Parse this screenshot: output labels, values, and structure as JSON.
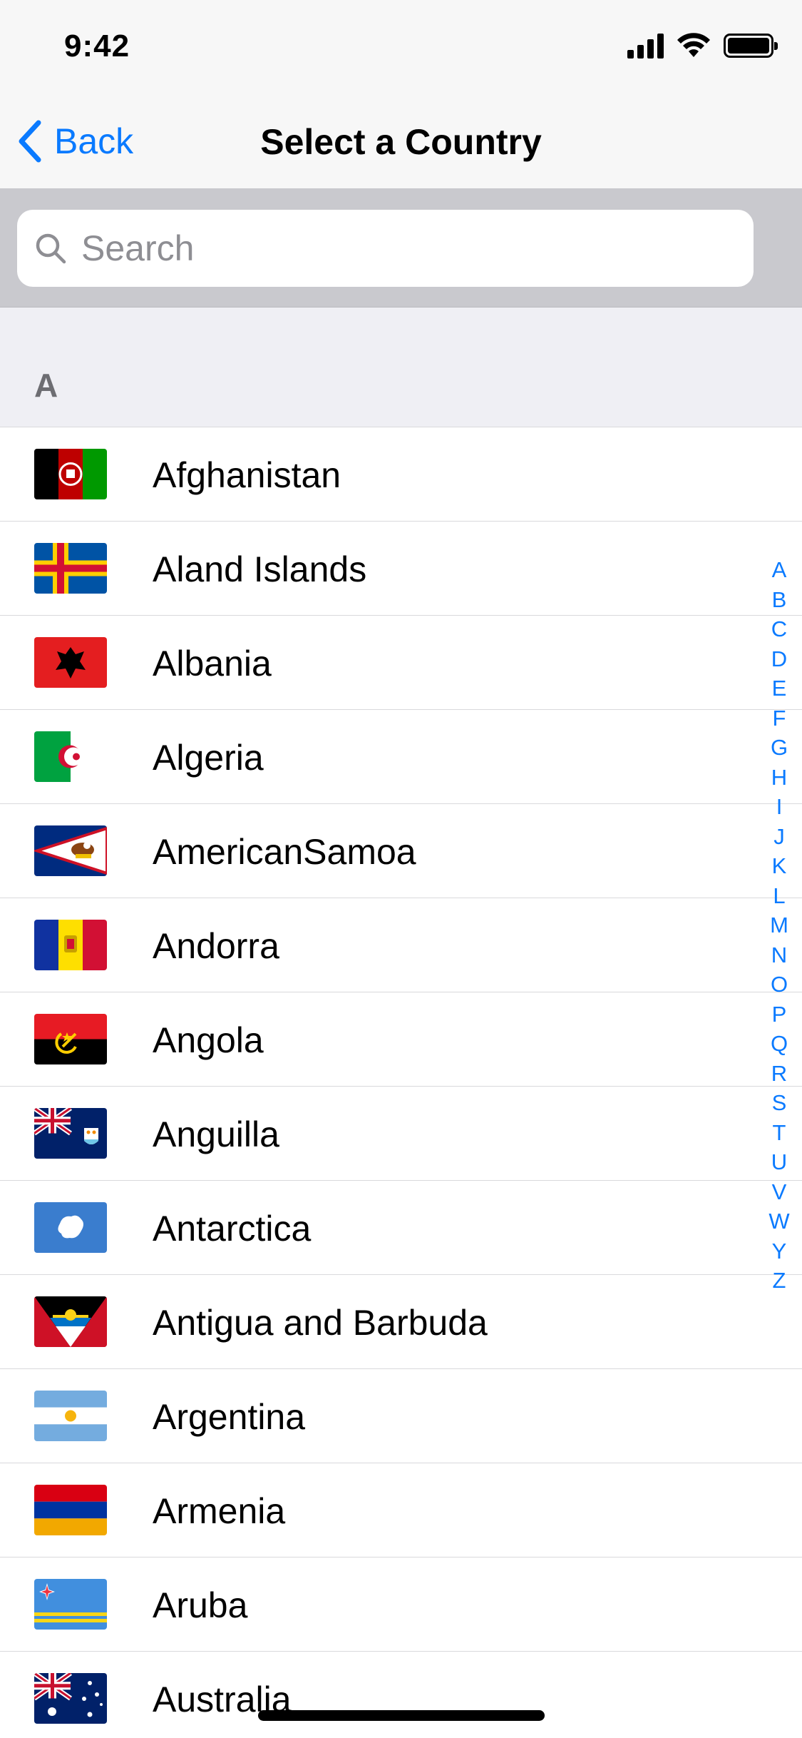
{
  "status_bar": {
    "time": "9:42"
  },
  "nav": {
    "back_label": "Back",
    "title": "Select a Country"
  },
  "search": {
    "placeholder": "Search",
    "value": ""
  },
  "section": {
    "letter": "A"
  },
  "countries": [
    {
      "name": "Afghanistan",
      "flag_icon": "flag-afghanistan-icon"
    },
    {
      "name": "Aland Islands",
      "flag_icon": "flag-aland-islands-icon"
    },
    {
      "name": "Albania",
      "flag_icon": "flag-albania-icon"
    },
    {
      "name": "Algeria",
      "flag_icon": "flag-algeria-icon"
    },
    {
      "name": "AmericanSamoa",
      "flag_icon": "flag-american-samoa-icon"
    },
    {
      "name": "Andorra",
      "flag_icon": "flag-andorra-icon"
    },
    {
      "name": "Angola",
      "flag_icon": "flag-angola-icon"
    },
    {
      "name": "Anguilla",
      "flag_icon": "flag-anguilla-icon"
    },
    {
      "name": "Antarctica",
      "flag_icon": "flag-antarctica-icon"
    },
    {
      "name": "Antigua and Barbuda",
      "flag_icon": "flag-antigua-barbuda-icon"
    },
    {
      "name": "Argentina",
      "flag_icon": "flag-argentina-icon"
    },
    {
      "name": "Armenia",
      "flag_icon": "flag-armenia-icon"
    },
    {
      "name": "Aruba",
      "flag_icon": "flag-aruba-icon"
    },
    {
      "name": "Australia",
      "flag_icon": "flag-australia-icon"
    }
  ],
  "index_letters": [
    "A",
    "B",
    "C",
    "D",
    "E",
    "F",
    "G",
    "H",
    "I",
    "J",
    "K",
    "L",
    "M",
    "N",
    "O",
    "P",
    "Q",
    "R",
    "S",
    "T",
    "U",
    "V",
    "W",
    "Y",
    "Z"
  ],
  "colors": {
    "accent": "#0a7aff",
    "nav_background": "#f7f7f7",
    "search_area_background": "#c9c9ce",
    "section_background": "#efeff4",
    "separator": "#d9d9dc",
    "section_text": "#6d6d72",
    "placeholder_text": "#8e8e93"
  }
}
